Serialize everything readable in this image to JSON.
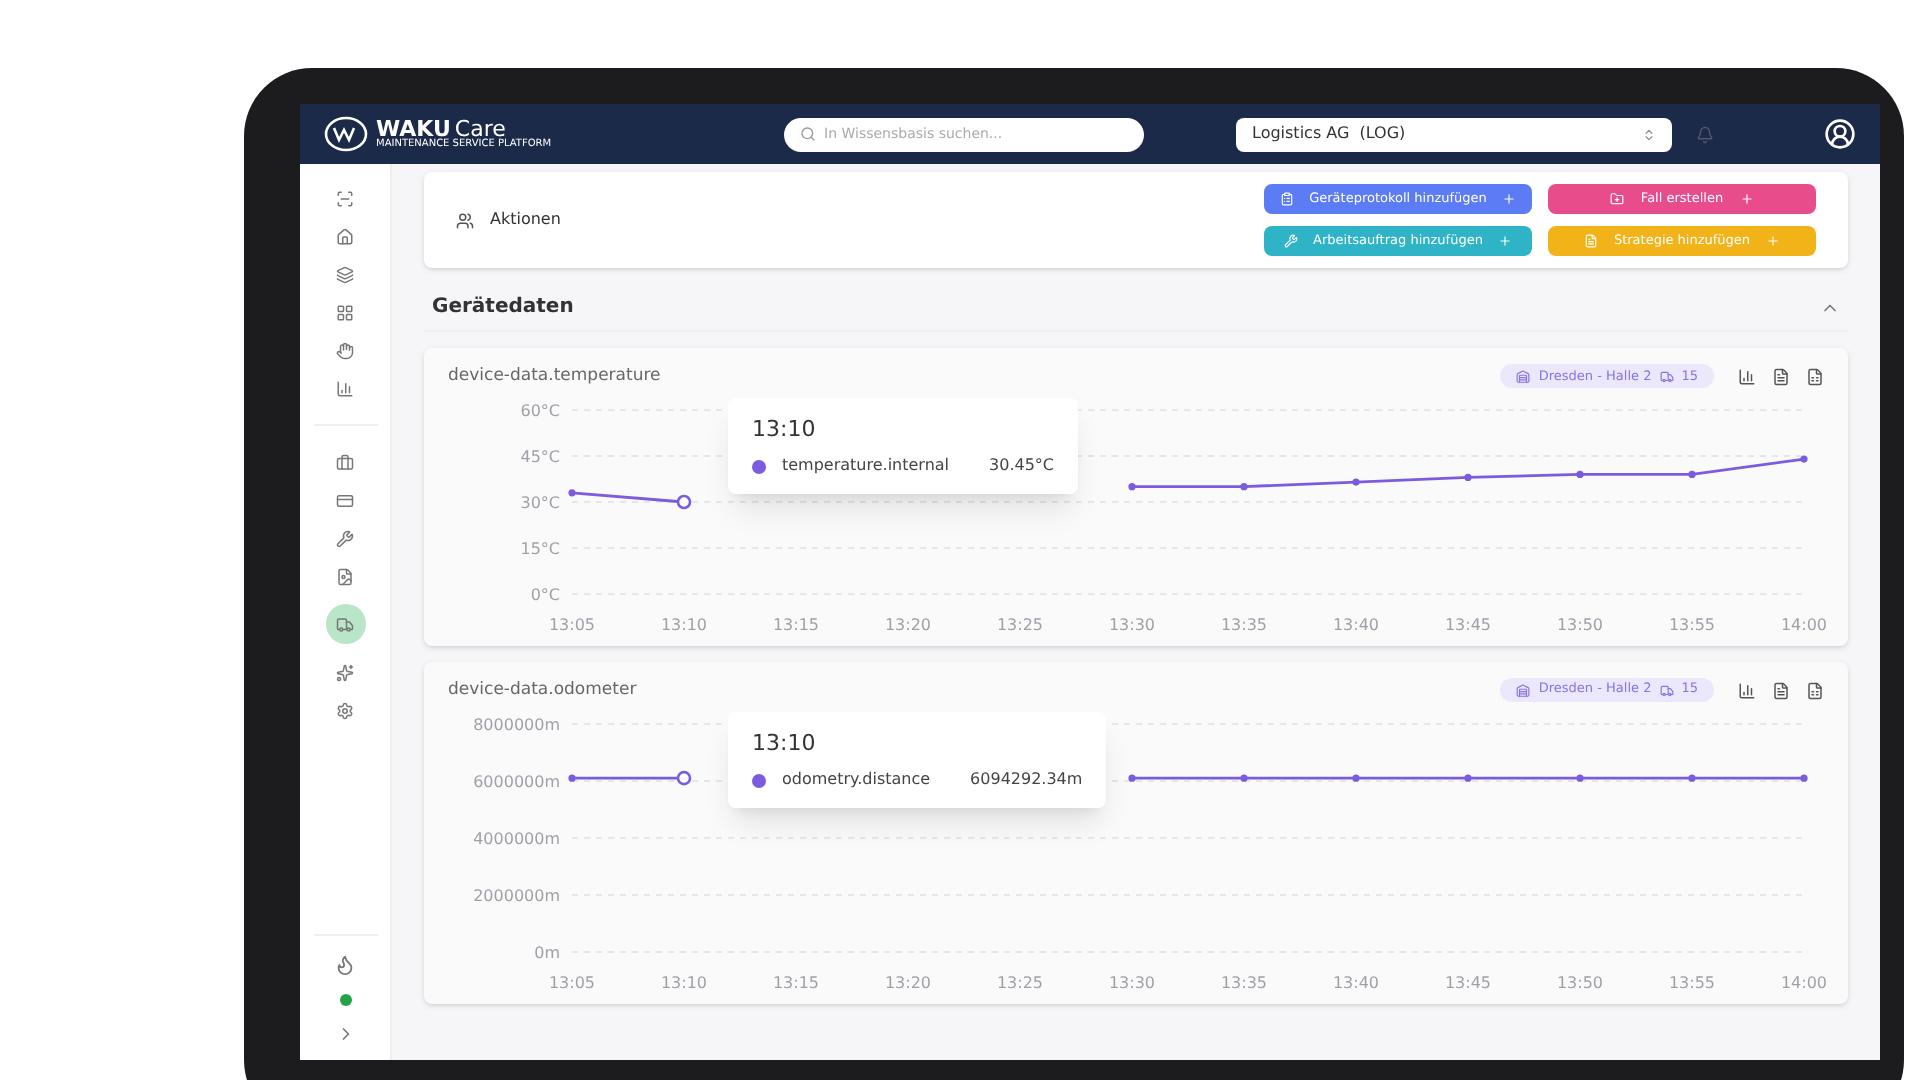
{
  "header": {
    "logo": {
      "brand": "WAKU",
      "product": "Care",
      "tagline": "MAINTENANCE SERVICE PLATFORM"
    },
    "search": {
      "placeholder": "In Wissensbasis suchen..."
    },
    "company_select": {
      "value": "Logistics AG  (LOG)"
    }
  },
  "sidebar": {
    "items": [
      {
        "selected": false
      },
      {
        "selected": false
      },
      {
        "selected": false
      },
      {
        "selected": false
      },
      {
        "selected": false
      },
      {
        "selected": false
      },
      {
        "selected": false
      },
      {
        "selected": false
      },
      {
        "selected": false
      },
      {
        "selected": false
      },
      {
        "selected": true
      },
      {
        "selected": false
      },
      {
        "selected": false
      }
    ],
    "status": {
      "color": "#22a34a"
    }
  },
  "actions": {
    "title": "Aktionen",
    "buttons": [
      {
        "label": "Geräteprotokoll hinzufügen",
        "color": "#5b7cf5"
      },
      {
        "label": "Fall erstellen",
        "color": "#e84c8b"
      },
      {
        "label": "Arbeitsauftrag hinzufügen",
        "color": "#2fb3c6"
      },
      {
        "label": "Strategie hinzufügen",
        "color": "#f2b318"
      }
    ]
  },
  "device_data": {
    "title": "Gerätedaten",
    "expanded": true,
    "charts": [
      {
        "title": "device-data.temperature",
        "location": "Dresden - Halle 2",
        "vehicle_count": "15",
        "tooltip": {
          "time": "13:10",
          "value": "30.45°C"
        },
        "chart_data": {
          "type": "line",
          "grid": true,
          "categories": [
            "13:05",
            "13:10",
            "13:15",
            "13:20",
            "13:25",
            "13:30",
            "13:35",
            "13:40",
            "13:45",
            "13:50",
            "13:55",
            "14:00"
          ],
          "series": [
            {
              "name": "temperature.internal",
              "color": "#7b5ce0",
              "marker": true,
              "values": [
                33,
                30,
                null,
                null,
                null,
                35,
                35,
                36.5,
                38,
                39,
                39,
                44
              ]
            }
          ],
          "ylim": [
            0,
            60
          ],
          "yticks": [
            {
              "value": 0,
              "label": "0°C"
            },
            {
              "value": 15,
              "label": "15°C"
            },
            {
              "value": 30,
              "label": "30°C"
            },
            {
              "value": 45,
              "label": "45°C"
            },
            {
              "value": 60,
              "label": "60°C"
            }
          ]
        }
      },
      {
        "title": "device-data.odometer",
        "location": "Dresden - Halle 2",
        "vehicle_count": "15",
        "tooltip": {
          "time": "13:10",
          "value": "6094292.34m"
        },
        "chart_data": {
          "type": "line",
          "grid": true,
          "categories": [
            "13:05",
            "13:10",
            "13:15",
            "13:20",
            "13:25",
            "13:30",
            "13:35",
            "13:40",
            "13:45",
            "13:50",
            "13:55",
            "14:00"
          ],
          "series": [
            {
              "name": "odometry.distance",
              "color": "#7b5ce0",
              "marker": true,
              "values": [
                6100000,
                6100000,
                null,
                null,
                null,
                6100000,
                6100000,
                6100000,
                6100000,
                6100000,
                6100000,
                6100000
              ]
            }
          ],
          "ylim": [
            0,
            8000000
          ],
          "yticks": [
            {
              "value": 0,
              "label": "0m"
            },
            {
              "value": 2000000,
              "label": "2000000m"
            },
            {
              "value": 4000000,
              "label": "4000000m"
            },
            {
              "value": 6000000,
              "label": "6000000m"
            },
            {
              "value": 8000000,
              "label": "8000000m"
            }
          ]
        }
      }
    ]
  }
}
